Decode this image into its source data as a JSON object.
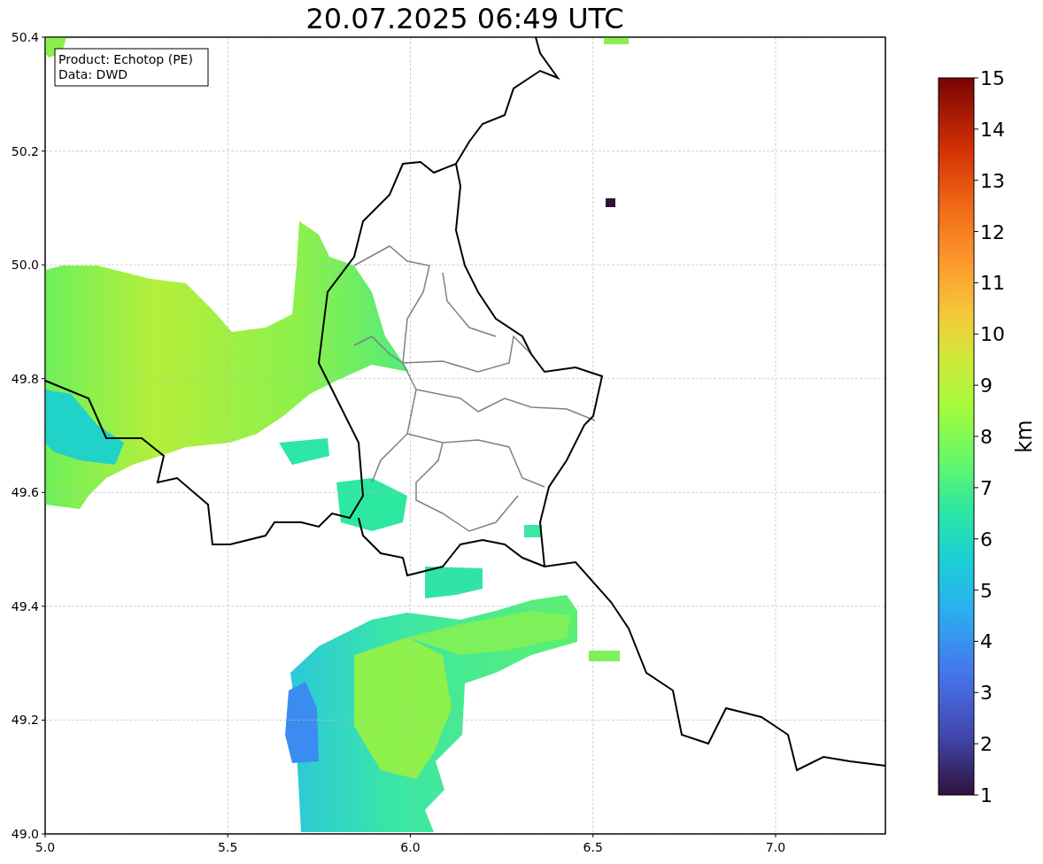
{
  "title": "20.07.2025 06:49 UTC",
  "legend": [
    "Product: Echotop (PE)",
    "Data: DWD"
  ],
  "x_ticks": [
    "5.0",
    "5.5",
    "6.0",
    "6.5",
    "7.0"
  ],
  "y_ticks": [
    "50.4",
    "50.2",
    "50.0",
    "49.8",
    "49.6",
    "49.4",
    "49.2",
    "49.0"
  ],
  "colorbar": {
    "label": "km",
    "ticks": [
      "15",
      "14",
      "13",
      "12",
      "11",
      "10",
      "9",
      "8",
      "7",
      "6",
      "5",
      "4",
      "3",
      "2",
      "1"
    ]
  }
}
